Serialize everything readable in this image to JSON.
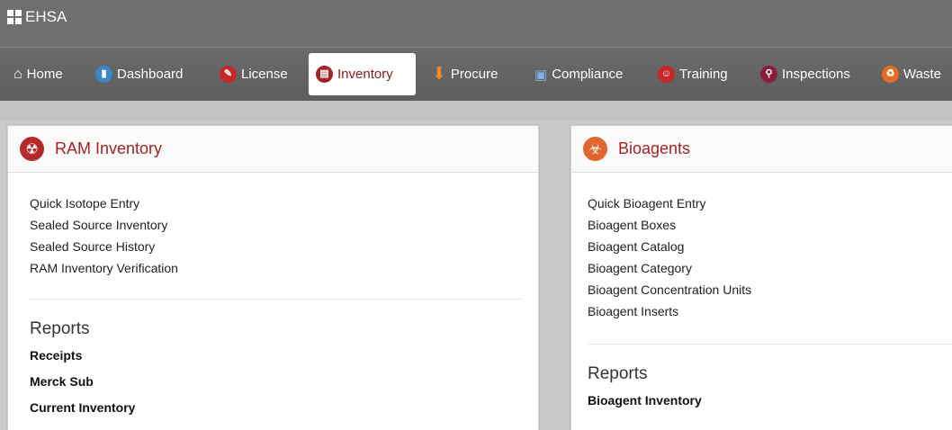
{
  "app": {
    "title": "EHSA"
  },
  "nav": {
    "items": [
      {
        "label": "Home",
        "icon": "home-icon"
      },
      {
        "label": "Dashboard",
        "icon": "dashboard-icon"
      },
      {
        "label": "License",
        "icon": "wrench-icon"
      },
      {
        "label": "Inventory",
        "icon": "inventory-icon"
      },
      {
        "label": "Procure",
        "icon": "arrow-down-icon"
      },
      {
        "label": "Compliance",
        "icon": "clipboard-icon"
      },
      {
        "label": "Training",
        "icon": "training-icon"
      },
      {
        "label": "Inspections",
        "icon": "search-icon"
      },
      {
        "label": "Waste",
        "icon": "trash-icon"
      }
    ],
    "active": "Inventory"
  },
  "ram_panel": {
    "title": "RAM Inventory",
    "icon": "radiation-icon",
    "links": [
      "Quick Isotope Entry",
      "Sealed Source Inventory",
      "Sealed Source History",
      "RAM Inventory Verification"
    ],
    "reports_title": "Reports",
    "reports": [
      "Receipts",
      "Merck Sub",
      "Current Inventory"
    ]
  },
  "bio_panel": {
    "title": "Bioagents",
    "icon": "biohazard-icon",
    "links": [
      "Quick Bioagent Entry",
      "Bioagent Boxes",
      "Bioagent Catalog",
      "Bioagent Category",
      "Bioagent Concentration Units",
      "Bioagent Inserts"
    ],
    "reports_title": "Reports",
    "reports": [
      "Bioagent Inventory"
    ]
  },
  "colors": {
    "accent": "#a42323",
    "radiation": "#b52a2a",
    "biohazard": "#e0662e"
  }
}
